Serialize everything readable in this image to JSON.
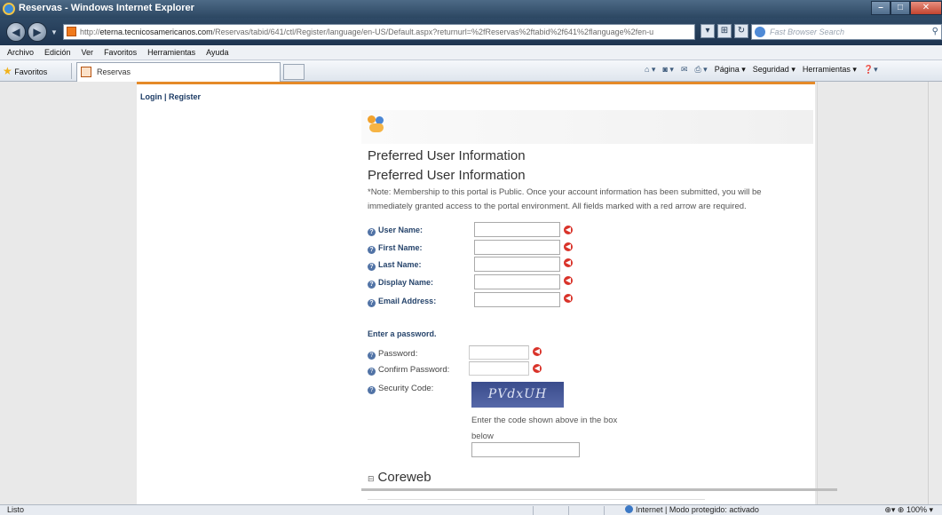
{
  "window": {
    "title": "Reservas - Windows Internet Explorer"
  },
  "address": {
    "url_prefix": "http://",
    "url_host": "eterna.tecnicosamericanos.com",
    "url_path": "/Reservas/tabid/641/ctl/Register/language/en-US/Default.aspx?returnurl=%2fReservas%2ftabid%2f641%2flanguage%2fen-u",
    "search_placeholder": "Fast Browser Search"
  },
  "menu": {
    "items": [
      "Archivo",
      "Edición",
      "Ver",
      "Favoritos",
      "Herramientas",
      "Ayuda"
    ]
  },
  "favorites": {
    "label": "Favoritos",
    "tab_title": "Reservas"
  },
  "commandbar": {
    "items": [
      "Página",
      "Seguridad",
      "Herramientas"
    ]
  },
  "page": {
    "login_links": "Login | Register",
    "heading1": "Preferred User Information",
    "heading2": "Preferred User Information",
    "note": "*Note: Membership to this portal is Public. Once your account information has been submitted, you will be immediately granted access to the portal environment. All fields marked with a red arrow are required.",
    "fields": [
      {
        "label": "User Name:"
      },
      {
        "label": "First Name:"
      },
      {
        "label": "Last Name:"
      },
      {
        "label": "Display Name:"
      },
      {
        "label": "Email Address:"
      }
    ],
    "password_section": "Enter a password.",
    "password_label": "Password:",
    "confirm_label": "Confirm Password:",
    "security_label": "Security Code:",
    "captcha_text": "PVdxUH",
    "captcha_help": "Enter the code shown above in the box below",
    "coreweb_toggle": "⊟",
    "coreweb": "Coreweb"
  },
  "status": {
    "left": "Listo",
    "zone": "Internet | Modo protegido: activado",
    "zoom": "100%"
  }
}
